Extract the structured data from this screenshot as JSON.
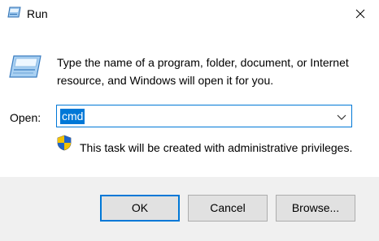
{
  "window": {
    "title": "Run",
    "icon": "run-icon",
    "close_icon": "close-icon"
  },
  "content": {
    "description": "Type the name of a program, folder, document, or Internet resource, and Windows will open it for you.",
    "open_label": "Open:",
    "open_value": "cmd",
    "dropdown_icon": "chevron-down-icon",
    "admin_note": "This task will be created with administrative privileges.",
    "admin_icon": "shield-icon"
  },
  "buttons": {
    "ok": "OK",
    "cancel": "Cancel",
    "browse": "Browse..."
  },
  "colors": {
    "accent": "#0078d7",
    "footer_bg": "#f0f0f0",
    "button_bg": "#e1e1e1"
  }
}
